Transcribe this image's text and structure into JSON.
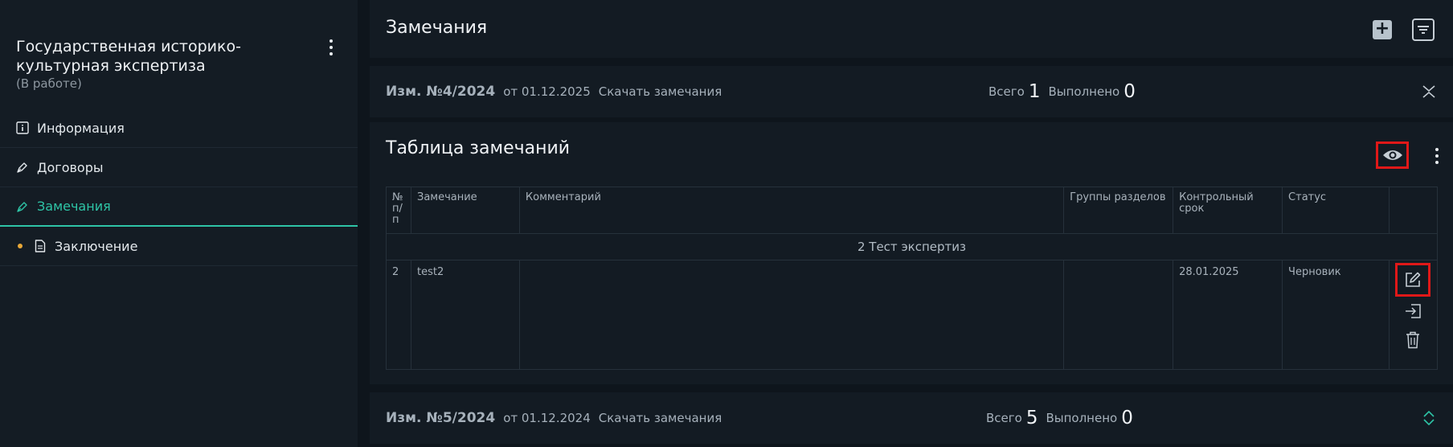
{
  "sidebar": {
    "title": "Государственная историко-культурная экспертиза",
    "status": "(В работе)",
    "items": [
      {
        "label": "Информация",
        "icon": "info-icon"
      },
      {
        "label": "Договоры",
        "icon": "pen-icon"
      },
      {
        "label": "Замечания",
        "icon": "pen-icon",
        "active": true
      },
      {
        "label": "Заключение",
        "icon": "document-icon"
      }
    ]
  },
  "header": {
    "title": "Замечания"
  },
  "revisions": [
    {
      "number": "Изм. №4/2024",
      "date": "от 01.12.2025",
      "download": "Скачать замечания",
      "total_label": "Всего",
      "total": "1",
      "done_label": "Выполнено",
      "done": "0",
      "expanded": true
    },
    {
      "number": "Изм. №5/2024",
      "date": "от 01.12.2024",
      "download": "Скачать замечания",
      "total_label": "Всего",
      "total": "5",
      "done_label": "Выполнено",
      "done": "0",
      "expanded": false
    }
  ],
  "remarks_table": {
    "title": "Таблица замечаний",
    "columns": [
      "№ п/п",
      "Замечание",
      "Комментарий",
      "Группы разделов",
      "Контрольный срок",
      "Статус"
    ],
    "group": "2 Тест экспертиз",
    "rows": [
      {
        "num": "2",
        "remark": "test2",
        "comment": "",
        "groups": "",
        "deadline": "28.01.2025",
        "status": "Черновик"
      }
    ]
  },
  "colors": {
    "accent": "#2ec4a6",
    "highlight": "#e01818",
    "status_dot": "#e8a838"
  }
}
